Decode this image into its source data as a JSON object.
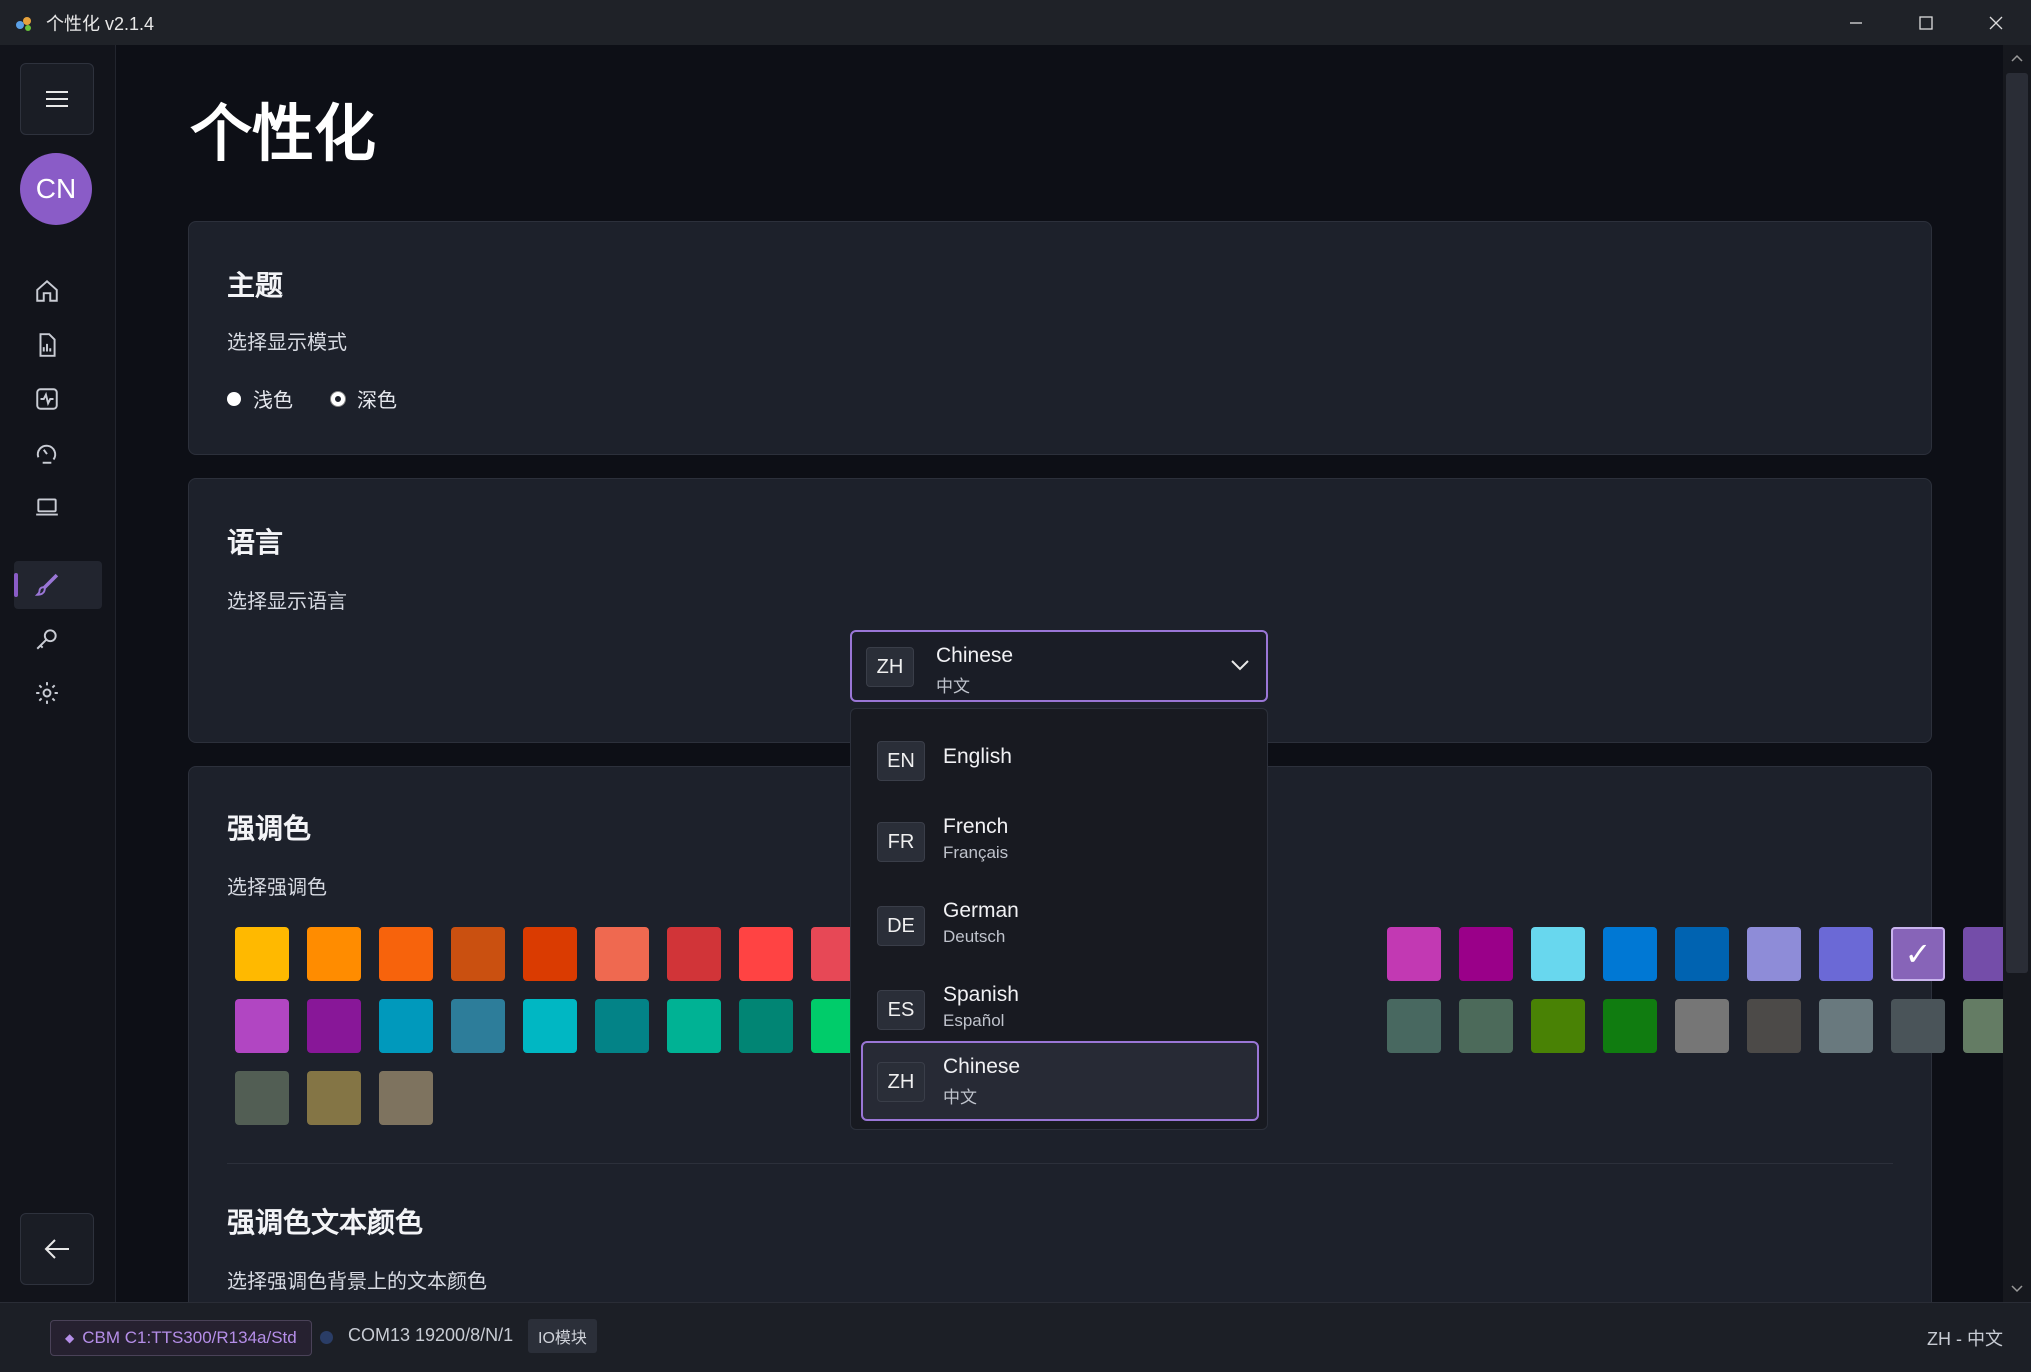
{
  "window": {
    "title": "个性化 v2.1.4"
  },
  "sidebar": {
    "avatar_initials": "CN",
    "items": [
      {
        "icon": "home-icon"
      },
      {
        "icon": "report-icon"
      },
      {
        "icon": "activity-icon"
      },
      {
        "icon": "gauge-icon"
      },
      {
        "icon": "laptop-icon"
      },
      {
        "icon": "brush-icon",
        "active": true
      },
      {
        "icon": "key-icon"
      },
      {
        "icon": "gear-icon"
      }
    ]
  },
  "page": {
    "title": "个性化"
  },
  "theme": {
    "title": "主题",
    "desc": "选择显示模式",
    "options": [
      "浅色",
      "深色"
    ],
    "selected": "深色"
  },
  "language": {
    "title": "语言",
    "desc": "选择显示语言",
    "selected": {
      "code": "ZH",
      "name": "Chinese",
      "native": "中文"
    },
    "options": [
      {
        "code": "EN",
        "name": "English",
        "native": ""
      },
      {
        "code": "FR",
        "name": "French",
        "native": "Français"
      },
      {
        "code": "DE",
        "name": "German",
        "native": "Deutsch"
      },
      {
        "code": "ES",
        "name": "Spanish",
        "native": "Español"
      },
      {
        "code": "ZH",
        "name": "Chinese",
        "native": "中文"
      }
    ]
  },
  "accent": {
    "title": "强调色",
    "desc": "选择强调色",
    "checkmark": "✓",
    "rows": [
      [
        "#ffb900",
        "#ff8c00",
        "#f7630c",
        "#ca5010",
        "#da3b01",
        "#ef6950",
        "#d13438",
        "#ff4343",
        "#e74856",
        "",
        "",
        "",
        "",
        "",
        "",
        "",
        "#c239b3",
        "#9a0089",
        "#68d7ee",
        "#0078d4",
        "#0063b1",
        "#8e8cd8",
        "#6b69d6",
        "#8764b8",
        "#744da9"
      ],
      [
        "#b146c2",
        "#881798",
        "#0099bc",
        "#2d7d9a",
        "#00b7c3",
        "#038387",
        "#00b294",
        "#018574",
        "#00cc6a",
        "",
        "",
        "",
        "",
        "",
        "",
        "",
        "#486860",
        "#4c6a5a",
        "#498205",
        "#107c10",
        "#767676",
        "#4c4a48",
        "#69797e",
        "#4a5459",
        "#647c64"
      ],
      [
        "#525e54",
        "#847545",
        "#7e735f"
      ]
    ],
    "selected_color": "#8764b8"
  },
  "accent_text": {
    "title": "强调色文本颜色",
    "desc": "选择强调色背景上的文本颜色"
  },
  "status": {
    "connection": "CBM C1:TTS300/R134a/Std",
    "port": "COM13 19200/8/N/1",
    "module": "IO模块",
    "language": "ZH - 中文"
  }
}
